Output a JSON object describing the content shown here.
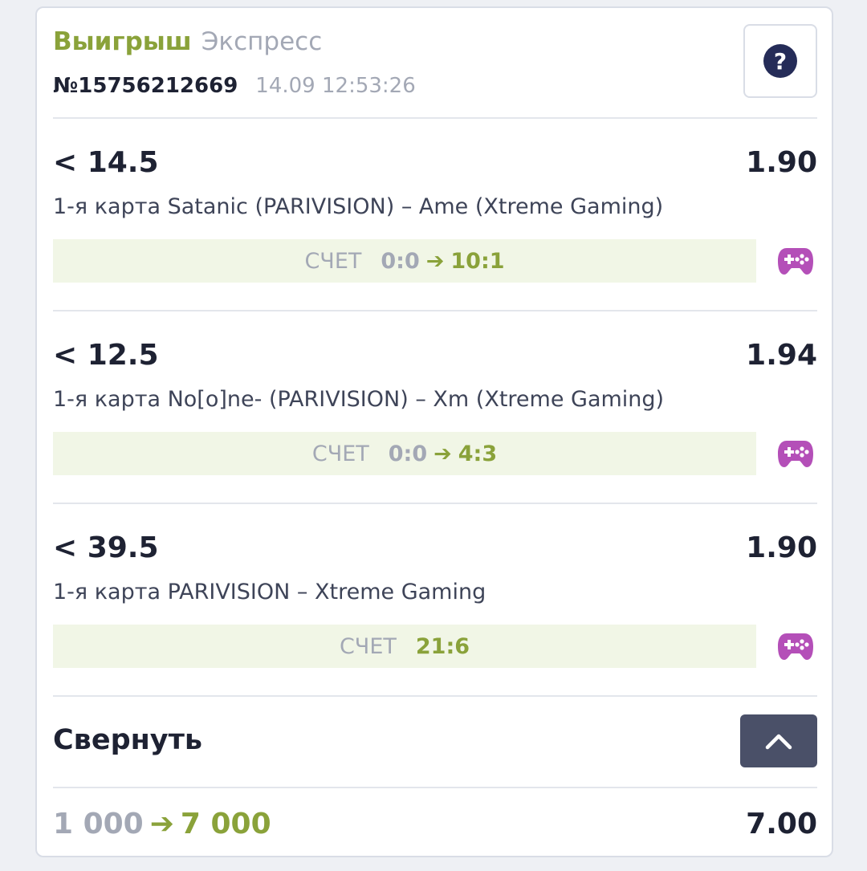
{
  "header": {
    "status": "Выигрыш",
    "bet_type": "Экспресс",
    "number": "№15756212669",
    "datetime": "14.09 12:53:26",
    "help_label": "?"
  },
  "events": [
    {
      "selection": "< 14.5",
      "odds": "1.90",
      "match": "1-я карта Satanic (PARIVISION) – Ame (Xtreme Gaming)",
      "score_label": "СЧЕТ",
      "score_from": "0:0",
      "score_to": "10:1",
      "icon": "gamepad-icon"
    },
    {
      "selection": "< 12.5",
      "odds": "1.94",
      "match": "1-я карта No[o]ne- (PARIVISION) – Xm (Xtreme Gaming)",
      "score_label": "СЧЕТ",
      "score_from": "0:0",
      "score_to": "4:3",
      "icon": "gamepad-icon"
    },
    {
      "selection": "< 39.5",
      "odds": "1.90",
      "match": "1-я карта PARIVISION – Xtreme Gaming",
      "score_label": "СЧЕТ",
      "score_from": "",
      "score_to": "21:6",
      "icon": "gamepad-icon"
    }
  ],
  "collapse": {
    "label": "Свернуть",
    "icon": "chevron-up-icon"
  },
  "totals": {
    "stake": "1 000",
    "payout": "7 000",
    "total_odds": "7.00"
  },
  "colors": {
    "win_green": "#8aa23a",
    "muted_gray": "#a3a8b5",
    "dark_text": "#1e2233",
    "score_bg": "#f1f6e6",
    "gamepad_purple": "#b44fb8",
    "help_navy": "#252c58",
    "collapse_button": "#4a5068"
  }
}
